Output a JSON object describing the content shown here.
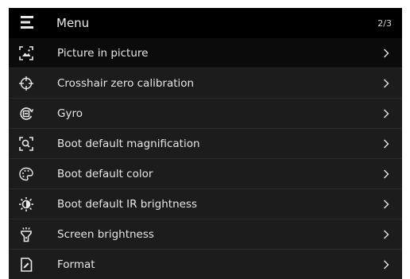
{
  "header": {
    "title": "Menu",
    "page_indicator": "2/3",
    "menu_icon": "hamburger-menu-icon"
  },
  "menu": {
    "selected_index": 0,
    "items": [
      {
        "label": "Picture in picture",
        "icon": "picture-in-picture-icon"
      },
      {
        "label": "Crosshair zero calibration",
        "icon": "crosshair-icon"
      },
      {
        "label": "Gyro",
        "icon": "gyro-icon"
      },
      {
        "label": "Boot default magnification",
        "icon": "magnification-icon"
      },
      {
        "label": "Boot default color",
        "icon": "palette-icon"
      },
      {
        "label": "Boot default IR brightness",
        "icon": "ir-brightness-icon"
      },
      {
        "label": "Screen brightness",
        "icon": "screen-brightness-icon"
      },
      {
        "label": "Format",
        "icon": "format-icon"
      }
    ]
  },
  "colors": {
    "background": "#161616",
    "header": "#000000",
    "selected_row": "#0b0b0b",
    "text": "#e6e6e6"
  }
}
